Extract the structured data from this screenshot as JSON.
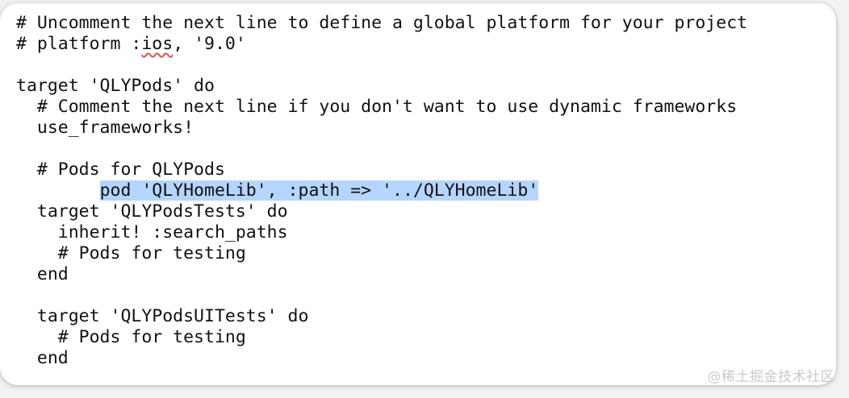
{
  "editor": {
    "lines": {
      "l1": "# Uncomment the next line to define a global platform for your project",
      "l2_pre": "# platform :",
      "l2_word": "ios",
      "l2_post": ", '9.0'",
      "l3": "",
      "l4": "target 'QLYPods' do",
      "l5": "  # Comment the next line if you don't want to use dynamic frameworks",
      "l6": "  use_frameworks!",
      "l7": "",
      "l8": "  # Pods for QLYPods",
      "l9_indent": "        ",
      "l9_selected": "pod 'QLYHomeLib', :path => '../QLYHomeLib'",
      "l10": "  target 'QLYPodsTests' do",
      "l11": "    inherit! :search_paths",
      "l12": "    # Pods for testing",
      "l13": "  end",
      "l14": "",
      "l15": "  target 'QLYPodsUITests' do",
      "l16": "    # Pods for testing",
      "l17": "  end"
    },
    "selection_color": "#b3d5fe",
    "spellcheck_color": "#e8504a"
  },
  "watermark": {
    "text": "@稀土掘金技术社区"
  }
}
